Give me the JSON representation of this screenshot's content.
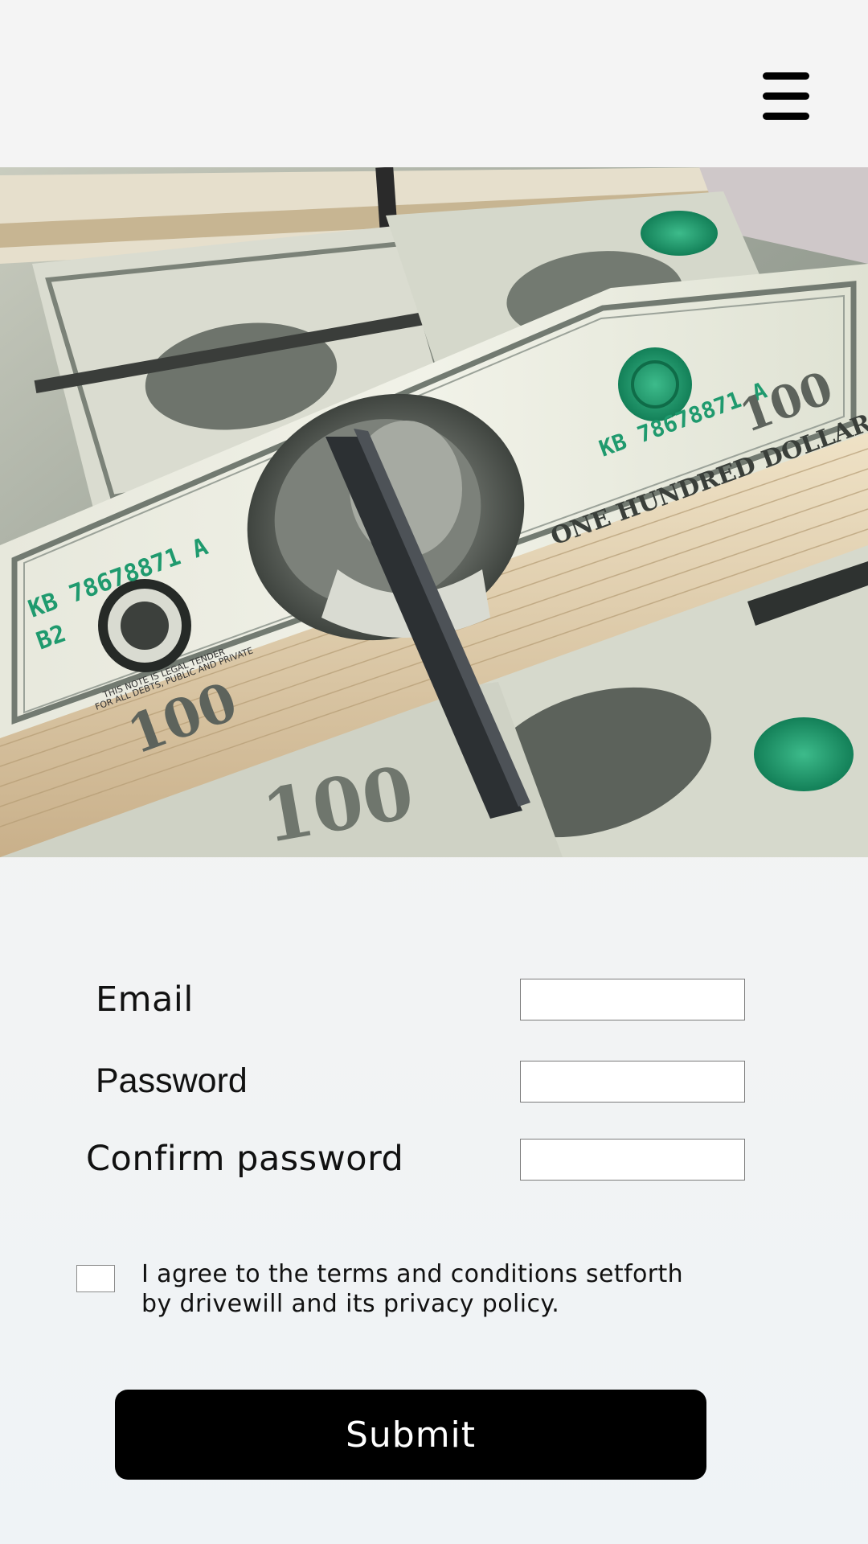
{
  "header": {
    "menu_icon": "hamburger-menu-icon"
  },
  "hero": {
    "image_subject": "stacks of 100 dollar bills",
    "bill_text": {
      "serial": "KB 78678871 A",
      "denomination": "100",
      "plate": "B2",
      "legal_line1": "THIS NOTE IS LEGAL TENDER",
      "legal_line2": "FOR ALL DEBTS, PUBLIC AND PRIVATE",
      "one_hundred": "ONE HUNDRED DOLLARS"
    }
  },
  "form": {
    "email_label": "Email",
    "password_label": "Password",
    "confirm_label": "Confirm password",
    "email_value": "",
    "password_value": "",
    "confirm_value": "",
    "terms_line1": "I agree to the terms and conditions setforth",
    "terms_line2": "by drivewill and its privacy policy.",
    "agree_checked": false,
    "submit_label": "Submit"
  },
  "colors": {
    "background": "#f3f3f3",
    "button": "#000000",
    "button_text": "#ffffff",
    "bill_green": "#1f9a6e"
  }
}
